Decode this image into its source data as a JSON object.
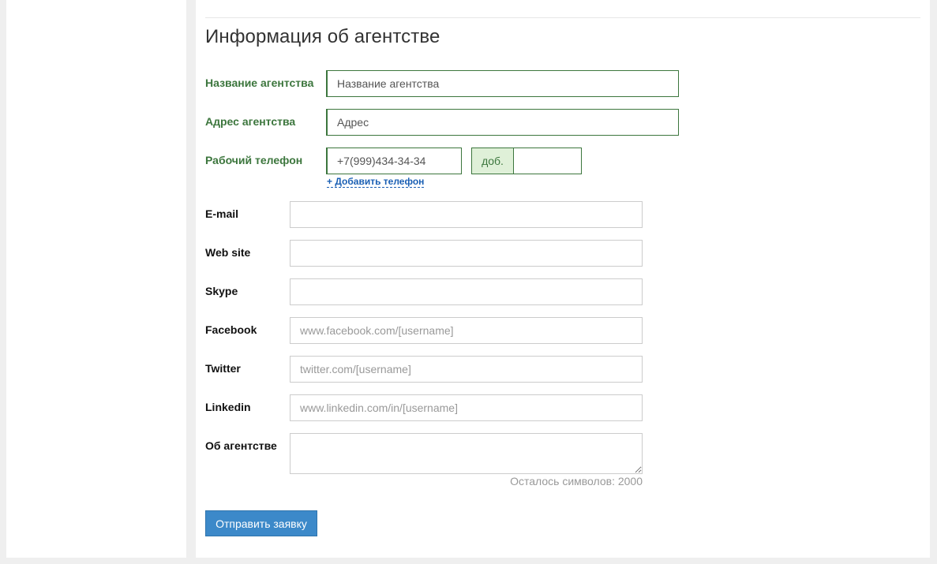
{
  "section": {
    "title": "Информация об агентстве"
  },
  "form": {
    "agency_name": {
      "label": "Название агентства",
      "placeholder": "Название агентства"
    },
    "agency_address": {
      "label": "Адрес агентства",
      "placeholder": "Адрес"
    },
    "work_phone": {
      "label": "Рабочий телефон",
      "placeholder": "+7(999)434-34-34",
      "ext_label": "доб.",
      "add_link": "+ Добавить телефон"
    },
    "email": {
      "label": "E-mail",
      "placeholder": ""
    },
    "website": {
      "label": "Web site",
      "placeholder": ""
    },
    "skype": {
      "label": "Skype",
      "placeholder": ""
    },
    "facebook": {
      "label": "Facebook",
      "placeholder": "www.facebook.com/[username]"
    },
    "twitter": {
      "label": "Twitter",
      "placeholder": "twitter.com/[username]"
    },
    "linkedin": {
      "label": "Linkedin",
      "placeholder": "www.linkedin.com/in/[username]"
    },
    "about": {
      "label": "Об агентстве",
      "counter": "Осталось символов: 2000"
    },
    "submit_label": "Отправить заявку"
  },
  "colors": {
    "required_accent": "#3c763d",
    "addon_bg": "#dff0d8",
    "link": "#1a5fb4",
    "primary_button": "#3c89c9"
  }
}
